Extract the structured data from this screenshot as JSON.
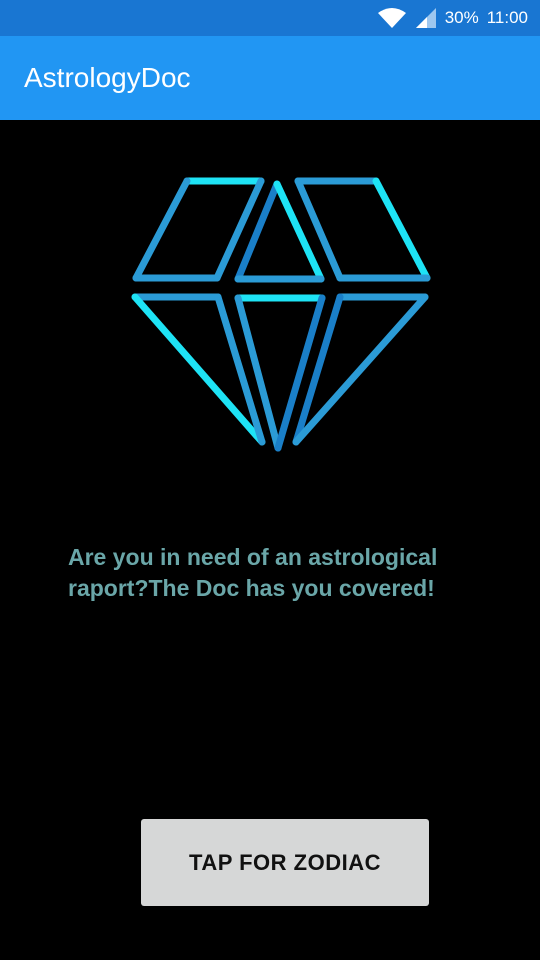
{
  "status_bar": {
    "battery": "30%",
    "time": "11:00",
    "icons": [
      "wifi-icon",
      "cell-signal-icon"
    ]
  },
  "app_bar": {
    "title": "AstrologyDoc"
  },
  "main": {
    "logo_icon": "diamond-icon",
    "tagline": "Are you in need of an astrological raport?The Doc has you covered!",
    "button_label": "TAP FOR ZODIAC"
  },
  "colors": {
    "status_bar": "#1976D2",
    "app_bar": "#2196F3",
    "background": "#000000",
    "tagline": "#6AA6A8",
    "button": "#D6D7D7",
    "diamond_cyan": "#1EE3F5",
    "diamond_blue": "#2B9BD6"
  }
}
